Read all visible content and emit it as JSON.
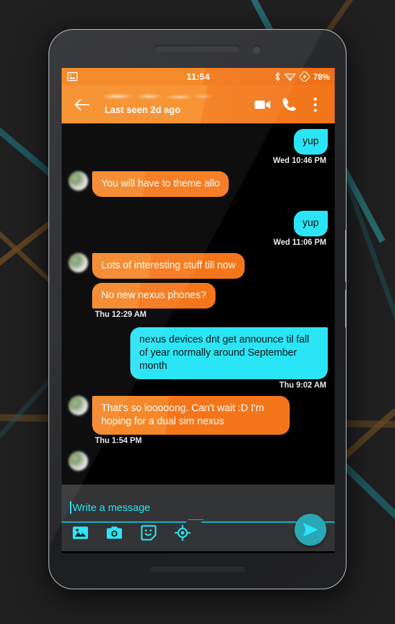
{
  "wallpaper": {
    "background_color": "#1f1f1f",
    "line_colors": [
      "#1f5f66",
      "#6b4a22",
      "#2c7f86"
    ]
  },
  "device": {
    "frame_color": "#b9bec6",
    "body_color": "#2a2b2d"
  },
  "status_bar": {
    "time": "11:54",
    "battery_percent": "78%",
    "icons": [
      "image-icon",
      "bluetooth-icon",
      "wifi-icon",
      "nfc-icon"
    ],
    "background_color": "#f2841f"
  },
  "app_bar": {
    "back_label": "Back",
    "contact_name": "",
    "contact_name_redacted": true,
    "subtitle": "Last seen 2d ago",
    "actions": [
      {
        "name": "video-call-icon",
        "label": "Video call"
      },
      {
        "name": "voice-call-icon",
        "label": "Call"
      },
      {
        "name": "overflow-menu-icon",
        "label": "More options"
      }
    ],
    "background_color": "#f78f2a"
  },
  "theme": {
    "incoming_bubble_color": "#f5761a",
    "outgoing_bubble_color": "#2ae5f5",
    "accent_color": "#2ae5f5",
    "chat_background": "#000000",
    "composer_background": "#333436"
  },
  "conversation": [
    {
      "id": "m1",
      "direction": "out",
      "text": "yup",
      "timestamp": "Wed 10:46 PM",
      "show_avatar": false
    },
    {
      "id": "m2",
      "direction": "in",
      "text": "You will have to theme allo",
      "timestamp": "",
      "show_avatar": true
    },
    {
      "id": "m3",
      "direction": "out",
      "text": "yup",
      "timestamp": "Wed 11:06 PM",
      "show_avatar": false
    },
    {
      "id": "m4",
      "direction": "in",
      "text": "Lots of interesting stuff till now",
      "timestamp": "",
      "show_avatar": true
    },
    {
      "id": "m5",
      "direction": "in",
      "text": "No new nexus phones?",
      "timestamp": "Thu 12:29 AM",
      "show_avatar": false
    },
    {
      "id": "m6",
      "direction": "out",
      "text": "nexus devices dnt get announce til fall of year normally around September month",
      "timestamp": "Thu 9:02 AM",
      "show_avatar": false
    },
    {
      "id": "m7",
      "direction": "in",
      "text": "That's so looooong. Can't wait :D I'm hoping for a dual sim nexus",
      "timestamp": "Thu 1:54 PM",
      "show_avatar": true
    }
  ],
  "composer": {
    "placeholder": "Write a message",
    "value": "",
    "tools": [
      {
        "name": "gallery-icon",
        "label": "Gallery"
      },
      {
        "name": "camera-icon",
        "label": "Camera"
      },
      {
        "name": "sticker-icon",
        "label": "Stickers"
      },
      {
        "name": "location-icon",
        "label": "Location"
      }
    ],
    "send_label": "Send"
  }
}
